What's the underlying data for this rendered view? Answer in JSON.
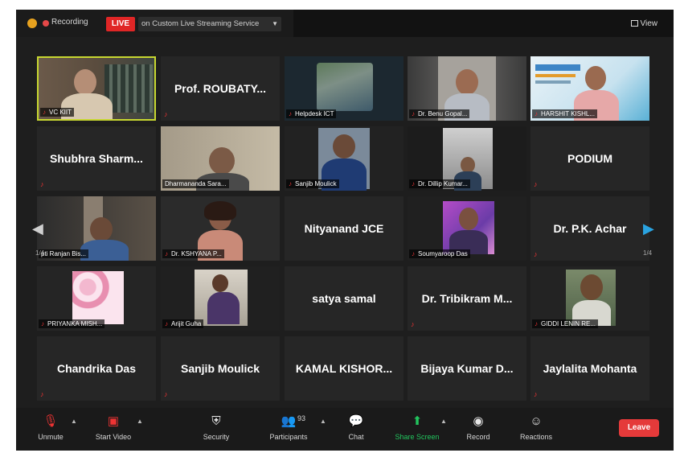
{
  "topbar": {
    "recording_label": "Recording",
    "live_label": "LIVE",
    "stream_label": "on Custom Live Streaming Service",
    "view_label": "View"
  },
  "tiles": {
    "vc_kiit": "VC KIIT",
    "roubaty": "Prof. ROUBATY...",
    "helpdesk": "Helpdesk ICT",
    "benu": "Dr. Benu Gopal...",
    "harshit": "HARSHIT KISHL...",
    "shubhra": "Shubhra Sharm...",
    "dharmananda": "Dharmananda Sara...",
    "sanjib_moulick_video": "Sanjib Moulick",
    "dillip": "Dr. Dillip Kumar...",
    "podium": "PODIUM",
    "ranjan": "pti Ranjan Bis...",
    "kshyana": "Dr. KSHYANA P...",
    "nityanand": "Nityanand JCE",
    "soumyaroop": "Soumyaroop Das",
    "pk_acharya": "Dr. P.K. Achar",
    "priyanka": "PRIYANKA MISH...",
    "arijit": "Arijit Guha",
    "satya": "satya samal",
    "tribikram": "Dr. Tribikram M...",
    "giddi": "GIDDI LENIN RE...",
    "chandrika": "Chandrika Das",
    "sanjib_moulick": "Sanjib Moulick",
    "kamal": "KAMAL KISHOR...",
    "bijaya": "Bijaya Kumar D...",
    "jaylalita": "Jaylalita Mohanta"
  },
  "nav": {
    "left_page": "1/4",
    "right_page": "1/4"
  },
  "toolbar": {
    "unmute": "Unmute",
    "start_video": "Start Video",
    "security": "Security",
    "participants": "Participants",
    "participants_count": "93",
    "chat": "Chat",
    "share_screen": "Share Screen",
    "record": "Record",
    "reactions": "Reactions",
    "leave": "Leave"
  },
  "colors": {
    "active_speaker_border": "#c7d730",
    "live_red": "#e02626",
    "share_green": "#22c55e",
    "leave_red": "#e53a3a",
    "nav_arrow_blue": "#2aa3e0"
  }
}
